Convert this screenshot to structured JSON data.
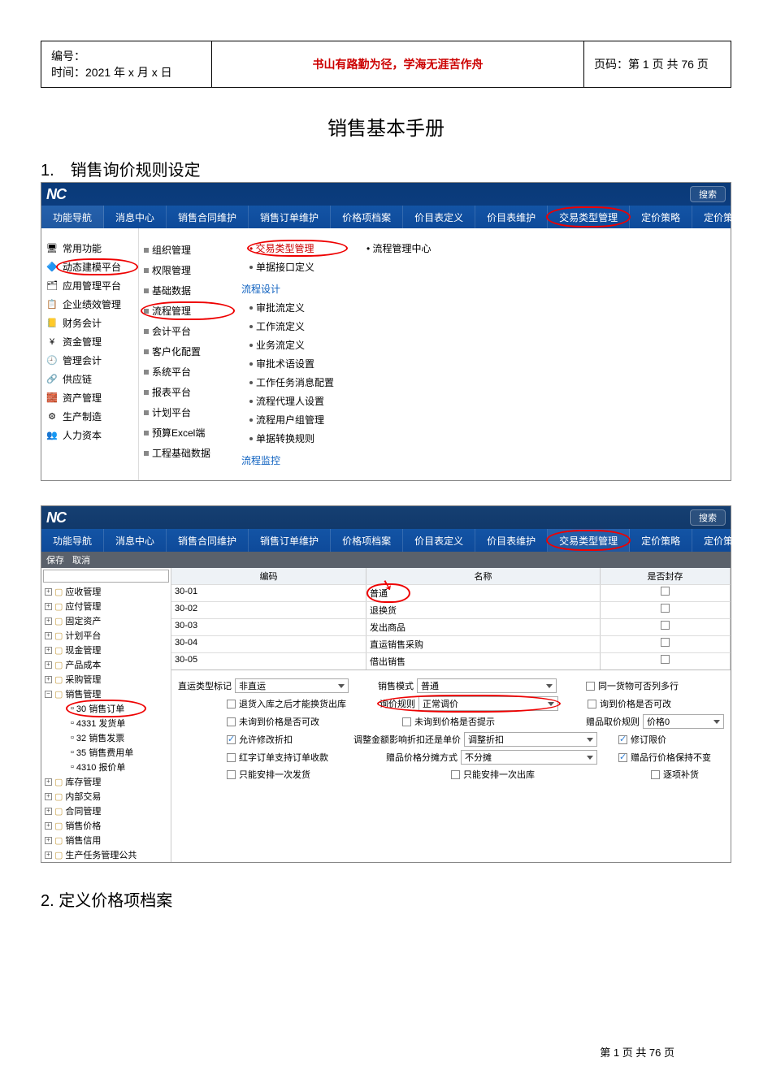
{
  "header": {
    "serial_label": "编号：",
    "time_label": "时间：2021 年 x 月 x 日",
    "motto": "书山有路勤为径，学海无涯苦作舟",
    "page_label": "页码：第 1 页 共 76 页"
  },
  "doc_title": "销售基本手册",
  "section1": "1.　销售询价规则设定",
  "section2": "2. 定义价格项档案",
  "footer": "第 1 页 共 76 页",
  "s1": {
    "logo": "NC",
    "search": "搜索",
    "tabs": [
      "功能导航",
      "消息中心",
      "销售合同维护",
      "销售订单维护",
      "价格项档案",
      "价目表定义",
      "价目表维护",
      "交易类型管理",
      "定价策略",
      "定价策略匹配设置"
    ],
    "nav": [
      {
        "icon": "🖥",
        "label": "常用功能"
      },
      {
        "icon": "🔷",
        "label": "动态建模平台",
        "ring": true
      },
      {
        "icon": "🗂",
        "label": "应用管理平台"
      },
      {
        "icon": "📋",
        "label": "企业绩效管理"
      },
      {
        "icon": "📒",
        "label": "财务会计"
      },
      {
        "icon": "¥",
        "label": "资金管理"
      },
      {
        "icon": "🕘",
        "label": "管理会计"
      },
      {
        "icon": "🔗",
        "label": "供应链"
      },
      {
        "icon": "🧱",
        "label": "资产管理"
      },
      {
        "icon": "⚙",
        "label": "生产制造"
      },
      {
        "icon": "👥",
        "label": "人力资本"
      }
    ],
    "mid": [
      {
        "label": "组织管理"
      },
      {
        "label": "权限管理"
      },
      {
        "label": "基础数据"
      },
      {
        "label": "流程管理",
        "ring": true
      },
      {
        "label": "会计平台"
      },
      {
        "label": "客户化配置"
      },
      {
        "label": "系统平台"
      },
      {
        "label": "报表平台"
      },
      {
        "label": "计划平台"
      },
      {
        "label": "预算Excel端"
      },
      {
        "label": "工程基础数据"
      }
    ],
    "col3": {
      "head1": "• 交易类型管理",
      "items1": [
        "单据接口定义"
      ],
      "head2": "流程设计",
      "items2": [
        "审批流定义",
        "工作流定义",
        "业务流定义",
        "审批术语设置",
        "工作任务消息配置",
        "流程代理人设置",
        "流程用户组管理",
        "单据转换规则"
      ],
      "head3": "流程监控"
    },
    "col4": "流程管理中心"
  },
  "s2": {
    "logo": "NC",
    "search": "搜索",
    "tabs": [
      "功能导航",
      "消息中心",
      "销售合同维护",
      "销售订单维护",
      "价格项档案",
      "价目表定义",
      "价目表维护",
      "交易类型管理",
      "定价策略",
      "定价策略匹配设置"
    ],
    "toolbar": {
      "save": "保存",
      "cancel": "取消"
    },
    "tree": [
      {
        "exp": "+",
        "label": "应收管理"
      },
      {
        "exp": "+",
        "label": "应付管理"
      },
      {
        "exp": "+",
        "label": "固定资产"
      },
      {
        "exp": "+",
        "label": "计划平台"
      },
      {
        "exp": "+",
        "label": "现金管理"
      },
      {
        "exp": "+",
        "label": "产品成本"
      },
      {
        "exp": "+",
        "label": "采购管理"
      },
      {
        "exp": "−",
        "label": "销售管理"
      },
      {
        "indent": 2,
        "label": "30 销售订单",
        "ring": true
      },
      {
        "indent": 2,
        "label": "4331 发货单"
      },
      {
        "indent": 2,
        "label": "32 销售发票"
      },
      {
        "indent": 2,
        "label": "35 销售费用单"
      },
      {
        "indent": 2,
        "label": "4310 报价单"
      },
      {
        "exp": "+",
        "label": "库存管理"
      },
      {
        "exp": "+",
        "label": "内部交易"
      },
      {
        "exp": "+",
        "label": "合同管理"
      },
      {
        "exp": "+",
        "label": "销售价格"
      },
      {
        "exp": "+",
        "label": "销售信用"
      },
      {
        "exp": "+",
        "label": "生产任务管理公共"
      }
    ],
    "grid": {
      "cols": {
        "code": "编码",
        "name": "名称",
        "sealed": "是否封存"
      },
      "rows": [
        {
          "code": "30-01",
          "name": "普通",
          "sealed": false,
          "ring": true
        },
        {
          "code": "30-02",
          "name": "退换货",
          "sealed": false
        },
        {
          "code": "30-03",
          "name": "发出商品",
          "sealed": false
        },
        {
          "code": "30-04",
          "name": "直运销售采购",
          "sealed": false
        },
        {
          "code": "30-05",
          "name": "借出销售",
          "sealed": false
        }
      ]
    },
    "form": {
      "r1": {
        "direct_label": "直运类型标记",
        "direct_val": "非直运",
        "mode_label": "销售模式",
        "mode_val": "普通",
        "sameitem": "同一货物可否列多行"
      },
      "r2": {
        "cb_return": "退货入库之后才能换货出库",
        "ask_rule_label": "询价规则",
        "ask_rule_val": "正常调价",
        "cb_ask_modifiable": "询到价格是否可改"
      },
      "r3": {
        "cb_noask_modifiable": "未询到价格是否可改",
        "cb_noask_hint": "未询到价格是否提示",
        "gift_rule_label": "赠品取价规则",
        "gift_rule_val": "价格0"
      },
      "r4": {
        "cb_allow_discount": "允许修改折扣",
        "adjust_label": "调整金额影响折扣还是单价",
        "adjust_val": "调整折扣",
        "cb_fix_price": "修订限价"
      },
      "r5": {
        "cb_red": "红字订单支持订单收款",
        "gift_split_label": "赠品价格分摊方式",
        "gift_split_val": "不分摊",
        "cb_gift_keep": "赠品行价格保持不变"
      },
      "r6": {
        "cb_ship_once": "只能安排一次发货",
        "cb_out_once": "只能安排一次出库",
        "cb_supply": "逐项补货"
      }
    }
  }
}
